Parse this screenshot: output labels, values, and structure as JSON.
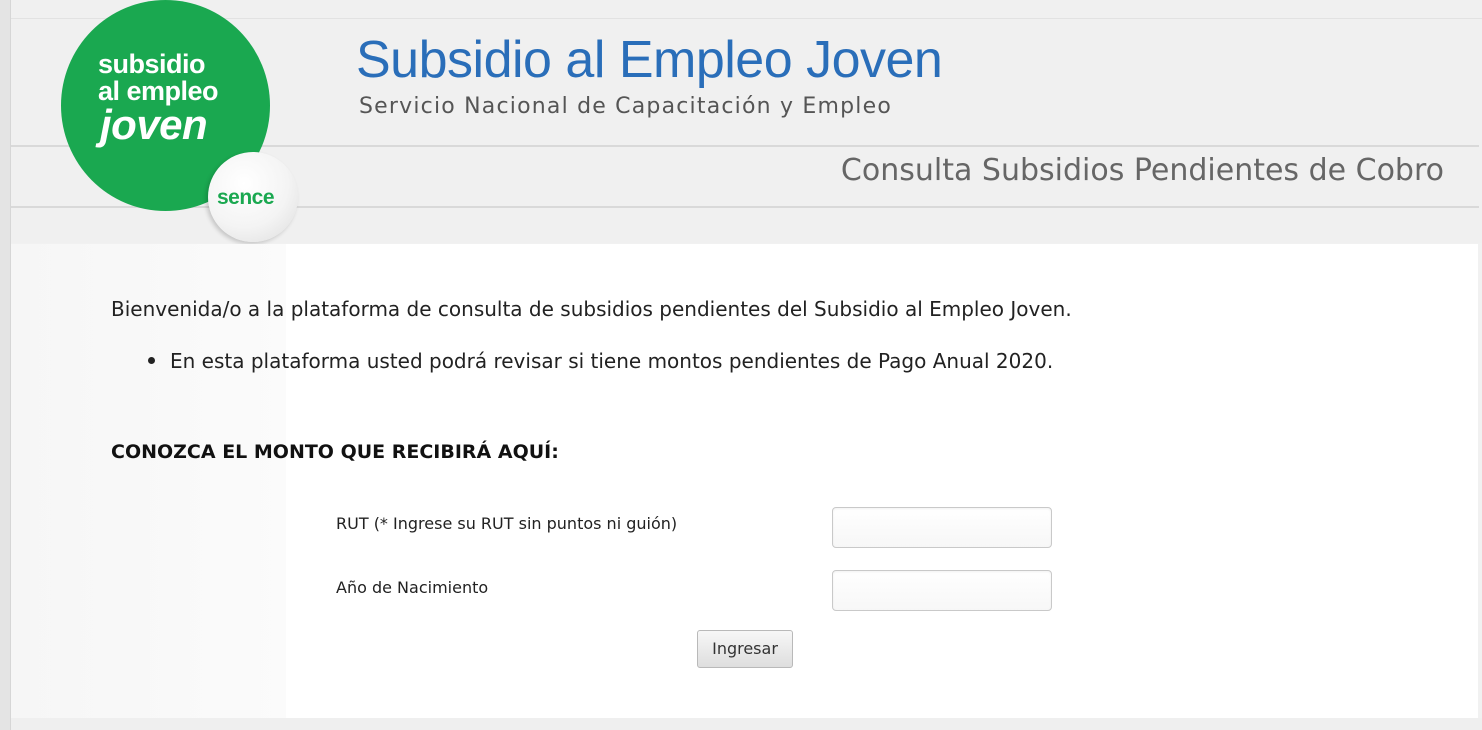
{
  "logo": {
    "line1": "subsidio",
    "line2": "al empleo",
    "line3": "joven",
    "badge": "sence",
    "brand_green": "#1aa850"
  },
  "header": {
    "title": "Subsidio al Empleo Joven",
    "subtitle": "Servicio Nacional de Capacitación y Empleo",
    "page_heading": "Consulta Subsidios Pendientes de Cobro",
    "title_color": "#2a6eb9"
  },
  "main": {
    "welcome": "Bienvenida/o a la plataforma de consulta de subsidios pendientes del Subsidio al Empleo Joven.",
    "bullets": [
      "En esta plataforma usted podrá revisar si tiene montos pendientes de Pago Anual 2020."
    ],
    "section_title": "CONOZCA EL MONTO QUE RECIBIRÁ AQUÍ:"
  },
  "form": {
    "rut_label": "RUT (* Ingrese su RUT sin puntos ni guión)",
    "rut_value": "",
    "year_label": "Año de Nacimiento",
    "year_value": "",
    "submit_label": "Ingresar"
  }
}
